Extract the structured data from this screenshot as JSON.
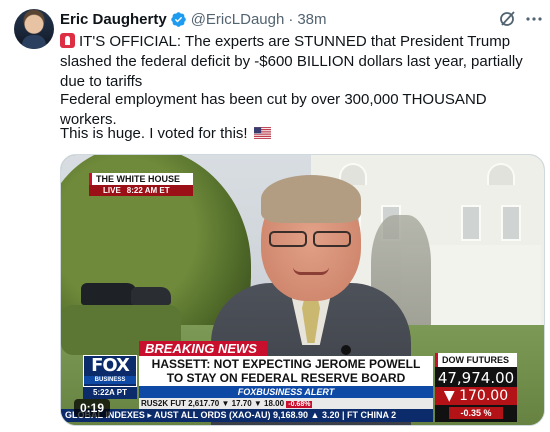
{
  "post": {
    "author_name": "Eric Daugherty",
    "handle": "@EricLDaugh",
    "separator": "·",
    "time": "38m",
    "text_line1": "IT'S OFFICIAL: The experts are STUNNED that President Trump slashed the federal deficit by -$600 BILLION dollars last year, partially due to tariffs",
    "text_line2": "Federal employment has been cut by over 300,000 THOUSAND workers.",
    "text_line3": "This is huge. I voted for this!"
  },
  "icons": {
    "verified": "verified-badge-icon",
    "grok": "grok-icon",
    "more": "more-icon",
    "alarm": "rotating-light-emoji",
    "flag": "us-flag-emoji"
  },
  "video": {
    "timestamp": "0:19",
    "location_title": "THE WHITE HOUSE",
    "live_label": "LIVE",
    "live_time": "8:22 AM ET",
    "breaking_label": "BREAKING NEWS",
    "headline_line1": "HASSETT: NOT EXPECTING JEROME POWELL",
    "headline_line2": "TO STAY ON FEDERAL RESERVE BOARD",
    "alert_label": "FOXBUSINESS ALERT",
    "fox_logo": "FOX",
    "fox_sub": "BUSINESS",
    "fox_time": "5:22A PT",
    "ticker_top": "RUS2K FUT   2,617.70  ▼ 17.70   ▼ 18.00",
    "ticker_top_pct": "-0.68%",
    "ticker_bottom": "GLOBAL INDEXES ▸ AUST ALL ORDS (XAO-AU)  9,168.90  ▲ 3.20  |  FT CHINA 2",
    "dow_label": "DOW FUTURES",
    "dow_value": "47,974.00",
    "dow_change": "170.00",
    "dow_pct": "-0.35 %"
  },
  "colors": {
    "link_gray": "#536471",
    "verified_blue": "#1d9bf0",
    "fox_red": "#c8102e",
    "fox_blue": "#0b2b6b"
  }
}
